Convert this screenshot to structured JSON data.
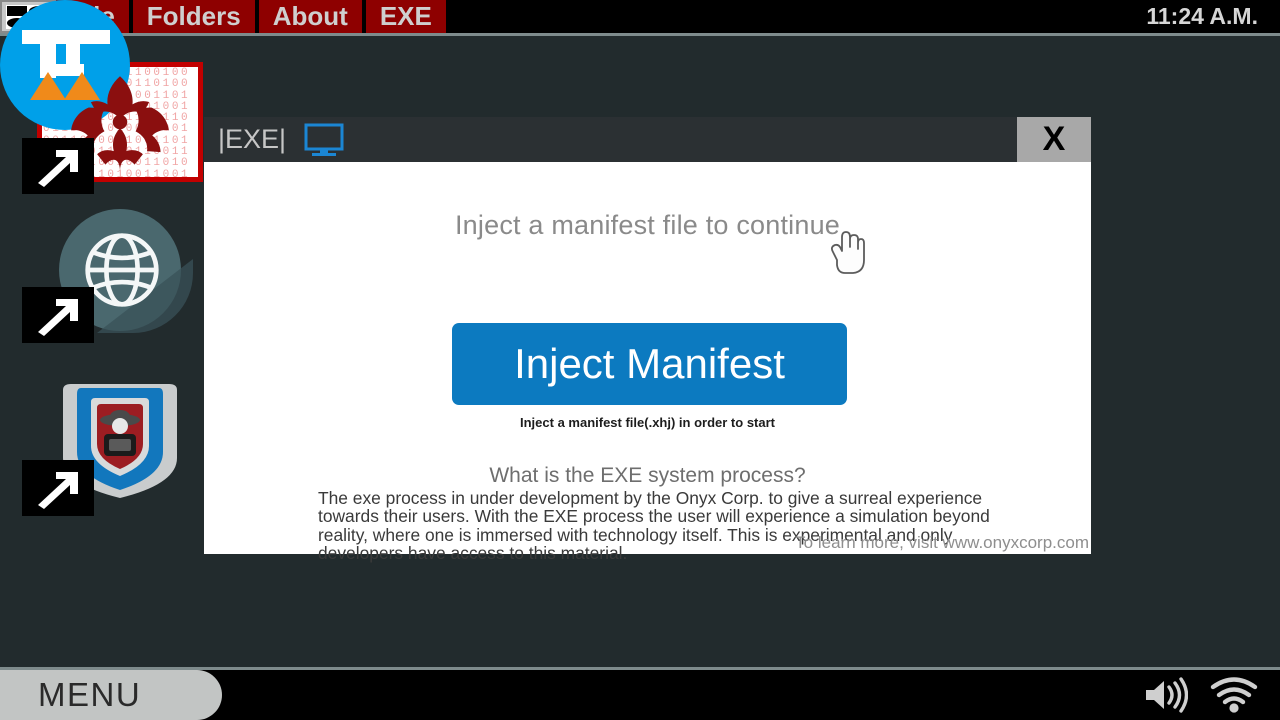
{
  "menubar": {
    "logo_icon": "app-grid-icon",
    "items": [
      {
        "label": "File",
        "name": "menu-file"
      },
      {
        "label": "Folders",
        "name": "menu-folders"
      },
      {
        "label": "About",
        "name": "menu-about"
      },
      {
        "label": "EXE",
        "name": "menu-exe"
      }
    ],
    "clock": "11:24 A.M.",
    "bar_color": "#000000",
    "item_color": "#8e0000",
    "text_color": "#cfcfcf"
  },
  "desktop": {
    "background_color": "#222b2d",
    "icons": [
      {
        "name": "desktop-icon-biohazard",
        "icon": "biohazard-icon",
        "shortcut": true,
        "binary": "1100101001100100110100110011010011001100110011010011001001101001100110100110011001100110100110010011010011001101001100110011001101001100100110100110011010011001100110011010011001001101001100110100110011001100110100110010011010011001101001100110011001101001100100110100110011010011001"
      },
      {
        "name": "desktop-icon-globe",
        "icon": "globe-icon",
        "shortcut": true
      },
      {
        "name": "desktop-icon-security-shield",
        "icon": "shield-spy-icon",
        "shortcut": true
      },
      {
        "name": "desktop-icon-blue-app",
        "icon": "blue-circle-icon",
        "shortcut": false
      }
    ]
  },
  "window": {
    "title": "|EXE|",
    "title_icon": "monitor-icon",
    "close_label": "X",
    "heading": "Inject a manifest file to continue",
    "button_label": "Inject Manifest",
    "button_color": "#0c7ac0",
    "hint": "Inject a manifest file(.xhj) in order to start",
    "about_heading": "What is the EXE system process?",
    "about_body": "The exe process in under development by the Onyx Corp. to give a surreal experience towards their users. With the EXE process the user will experience a simulation beyond reality, where one is immersed with technology itself. This is experimental and only developers have access to this material.",
    "learn_more": "To learn more, visit www.onyxcorp.com"
  },
  "taskbar": {
    "menu_label": "MENU",
    "tray": [
      {
        "name": "volume-icon"
      },
      {
        "name": "wifi-icon"
      }
    ]
  },
  "cursor": {
    "type": "pointer-hand-cursor"
  }
}
